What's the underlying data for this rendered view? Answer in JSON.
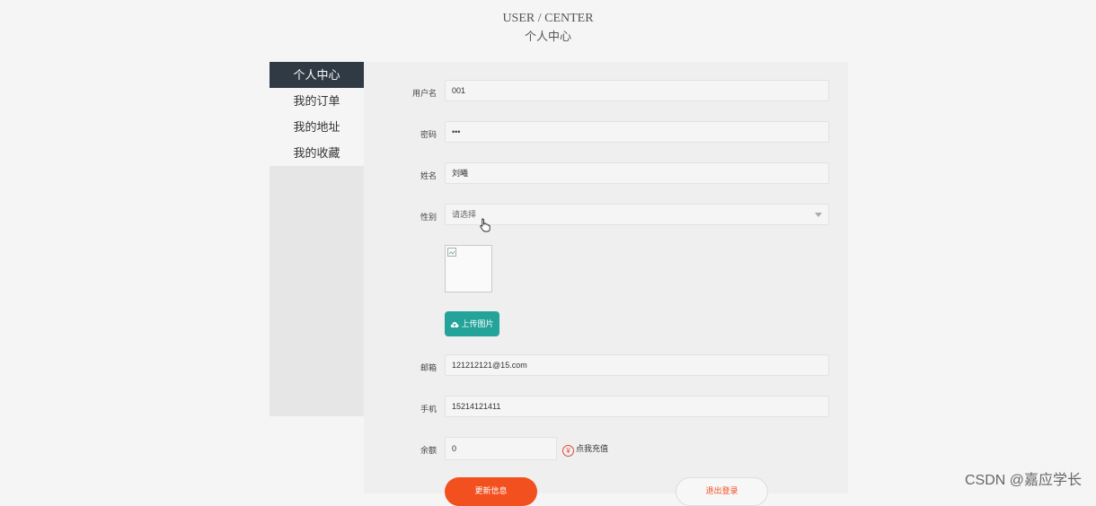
{
  "header": {
    "title_en": "USER / CENTER",
    "title_zh": "个人中心"
  },
  "sidebar": {
    "items": [
      {
        "label": "个人中心",
        "active": true
      },
      {
        "label": "我的订单",
        "active": false
      },
      {
        "label": "我的地址",
        "active": false
      },
      {
        "label": "我的收藏",
        "active": false
      }
    ]
  },
  "form": {
    "username": {
      "label": "用户名",
      "value": "001"
    },
    "password": {
      "label": "密码",
      "value": "•••"
    },
    "name": {
      "label": "姓名",
      "value": "刘曦"
    },
    "gender": {
      "label": "性别",
      "placeholder": "请选择"
    },
    "upload_label": "上传图片",
    "email": {
      "label": "邮箱",
      "value": "121212121@15.com"
    },
    "phone": {
      "label": "手机",
      "value": "15214121411"
    },
    "balance": {
      "label": "余额",
      "value": "0",
      "recharge_label": "点我充值",
      "currency_symbol": "¥"
    },
    "update_button": "更新信息",
    "logout_button": "退出登录"
  },
  "watermark": "CSDN @嘉应学长",
  "colors": {
    "sidebar_active": "#2f3a44",
    "upload": "#23a39a",
    "primary": "#f2501f"
  }
}
